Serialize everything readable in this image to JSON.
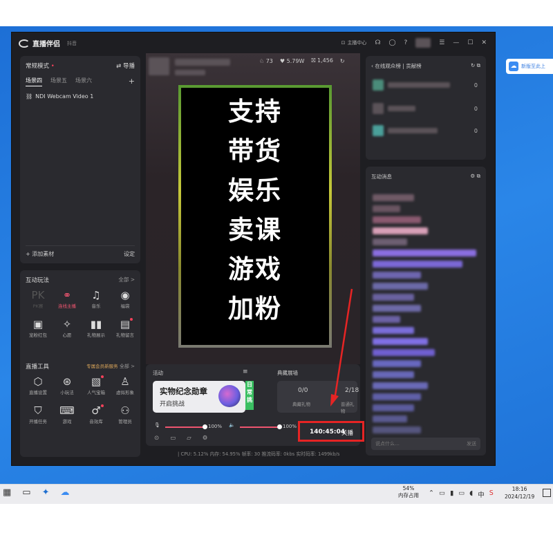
{
  "app": {
    "title": "直播伴侣",
    "platform": "抖音",
    "creator_center": "主播中心"
  },
  "scene": {
    "mode": "常规模式",
    "switch_label": "导播",
    "tabs": [
      "场景四",
      "场景五",
      "场景六"
    ],
    "add": "+",
    "source": "NDI Webcam Video 1",
    "add_material": "添加素材",
    "settings": "设定"
  },
  "interactive": {
    "title": "互动玩法",
    "all": "全部 >",
    "tools": [
      {
        "label": "PK赛",
        "icon": "PK",
        "state": "dim"
      },
      {
        "label": "连线主播",
        "icon": "⚭",
        "state": "pink"
      },
      {
        "label": "音乐",
        "icon": "♫",
        "state": ""
      },
      {
        "label": "福袋",
        "icon": "◉",
        "state": ""
      },
      {
        "label": "宠粉红包",
        "icon": "▣",
        "state": ""
      },
      {
        "label": "心愿",
        "icon": "✧",
        "state": ""
      },
      {
        "label": "礼物展示",
        "icon": "▮▮",
        "state": ""
      },
      {
        "label": "礼物留言",
        "icon": "▤",
        "state": "dot"
      }
    ]
  },
  "live_tools": {
    "title": "直播工具",
    "vip": "专属会员新服务",
    "all": "全部 >",
    "tools": [
      {
        "label": "直播设置",
        "icon": "⬡",
        "state": ""
      },
      {
        "label": "小玩法",
        "icon": "⊛",
        "state": ""
      },
      {
        "label": "人气宝箱",
        "icon": "▧",
        "state": "dot"
      },
      {
        "label": "虚拟形象",
        "icon": "♙",
        "state": ""
      },
      {
        "label": "开播任务",
        "icon": "⛉",
        "state": ""
      },
      {
        "label": "游戏",
        "icon": "⌨",
        "state": ""
      },
      {
        "label": "音效库",
        "icon": "♂",
        "state": "dot"
      },
      {
        "label": "管理员",
        "icon": "⚇",
        "state": ""
      }
    ]
  },
  "stats": {
    "viewers": "73",
    "likes": "5.79W",
    "gifts": "1,456"
  },
  "preview_lines": [
    "支持",
    "带货",
    "娱乐",
    "卖课",
    "游戏",
    "加粉"
  ],
  "activity": {
    "title": "活动",
    "menu": "≡",
    "card_title": "实物纪念勋章",
    "card_sub": "开启挑战",
    "tag": "日常挑"
  },
  "gifts": {
    "title": "典藏展墙",
    "value1": "0/0",
    "label1": "典藏礼物",
    "value2": "2/18",
    "label2": "普通礼物"
  },
  "audio": {
    "mic_pct": "100%",
    "speaker_pct": "100%"
  },
  "live": {
    "timer": "140:45:04",
    "close": "关播"
  },
  "status_bar": "| CPU: 5.12%   内存: 54.95%   帧率: 30   推流码率: 0kbs   实时码率: 1499kb/s",
  "viewers_panel": {
    "tab1": "在线观众榜",
    "tab2": "贡献榜",
    "rows": [
      "0",
      "0",
      "0"
    ]
  },
  "chat": {
    "title": "互动消息",
    "placeholder": "说点什么…",
    "send": "发送"
  },
  "taskbar": {
    "mem_pct": "54%",
    "mem_label": "内存占用",
    "ime": "中",
    "time": "18:16",
    "date": "2024/12/19"
  },
  "side_app": {
    "label": "新版至此上"
  }
}
